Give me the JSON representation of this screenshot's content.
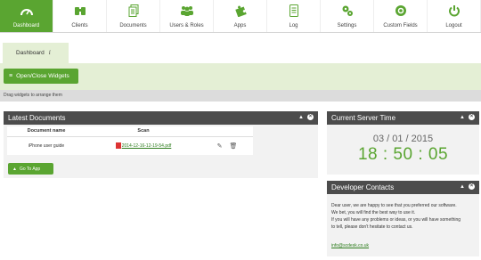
{
  "nav": {
    "items": [
      {
        "label": "Dashboard",
        "icon": "gauge-icon",
        "active": true
      },
      {
        "label": "Clients",
        "icon": "binoculars-icon",
        "active": false
      },
      {
        "label": "Documents",
        "icon": "documents-icon",
        "active": false
      },
      {
        "label": "Users & Roles",
        "icon": "users-icon",
        "active": false
      },
      {
        "label": "Apps",
        "icon": "puzzle-icon",
        "active": false
      },
      {
        "label": "Log",
        "icon": "log-icon",
        "active": false
      },
      {
        "label": "Settings",
        "icon": "gears-icon",
        "active": false
      },
      {
        "label": "Custom Fields",
        "icon": "custom-fields-icon",
        "active": false
      },
      {
        "label": "Logout",
        "icon": "power-icon",
        "active": false
      }
    ]
  },
  "tab": {
    "label": "Dashboard",
    "info_glyph": "i"
  },
  "widget_button": {
    "label": "Open/Close Widgets"
  },
  "hint": "Drag widgets to arrange them",
  "documents_panel": {
    "title": "Latest Documents",
    "columns": [
      "Document name",
      "Scan"
    ],
    "rows": [
      {
        "name": "iPhone user guide",
        "scan": "2014-12-16-12-19-54.pdf"
      }
    ],
    "go_button": "Go To App"
  },
  "time_panel": {
    "title": "Current Server Time",
    "date": "03 / 01 / 2015",
    "time": "18 : 50 : 05"
  },
  "contacts_panel": {
    "title": "Developer Contacts",
    "lines": [
      "Dear user, we are happy to see that you preferred our software.",
      "We bet, you will find the best way to use it.",
      "If you will have any problems or ideas, or you will have something",
      "to tell, please don't hesitate to contact us."
    ],
    "email": "info@scdesk.co.uk"
  },
  "colors": {
    "accent": "#5aa531",
    "panel_header": "#4c4c4c",
    "light_green": "#e4efd5"
  }
}
